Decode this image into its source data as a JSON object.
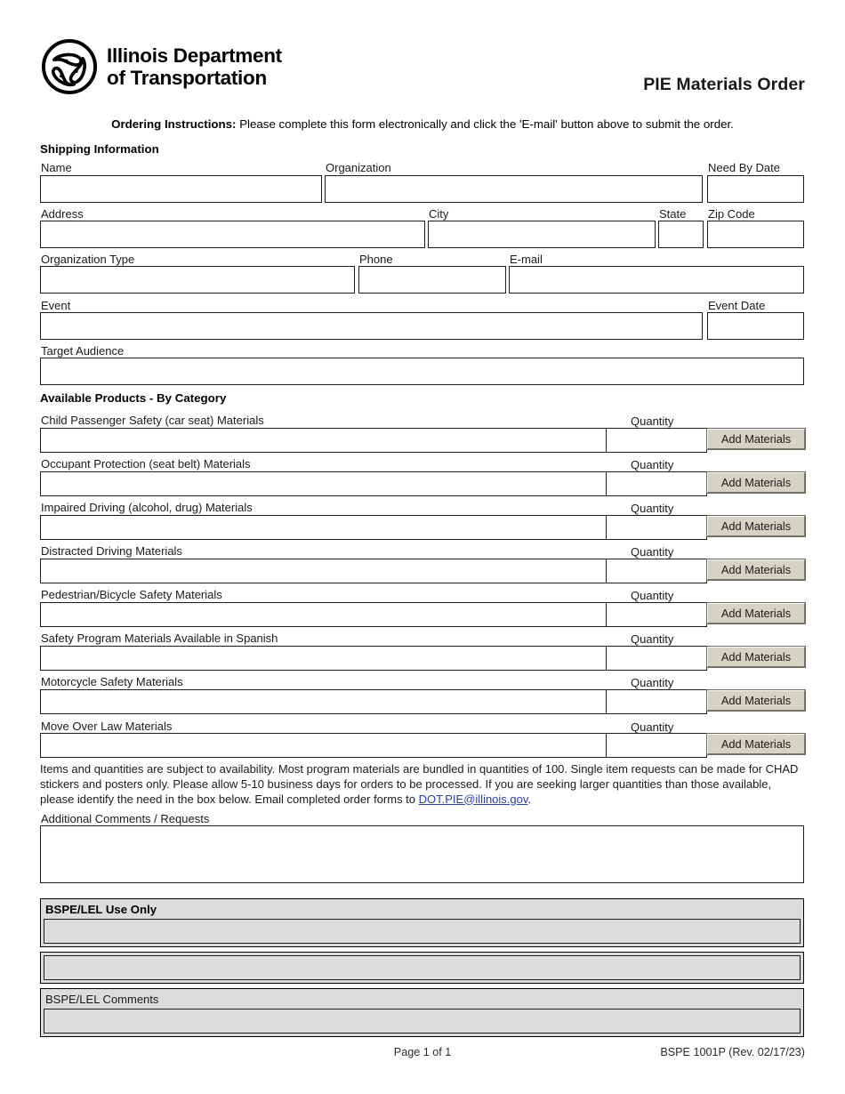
{
  "header": {
    "agency_line1": "Illinois Department",
    "agency_line2": "of Transportation",
    "logo_icon": "idot-triskelion-logo",
    "document_title": "PIE Materials Order"
  },
  "instructions": {
    "lead": "Ordering Instructions:",
    "text": "Please complete this form electronically and click the 'E-mail' button above to submit the order."
  },
  "shipping": {
    "title": "Shipping Information",
    "fields": [
      {
        "label": "Name",
        "value": "",
        "name": "name-field"
      },
      {
        "label": "Organization",
        "value": "",
        "name": "organization-field"
      },
      {
        "label": "Need By Date",
        "value": "",
        "name": "need-by-date-field"
      },
      {
        "label": "Address",
        "value": "",
        "name": "address-field"
      },
      {
        "label": "City",
        "value": "",
        "name": "city-field"
      },
      {
        "label": "State",
        "value": "",
        "name": "state-field"
      },
      {
        "label": "Zip Code",
        "value": "",
        "name": "zip-code-field"
      },
      {
        "label": "Organization Type",
        "value": "",
        "name": "organization-type-field"
      },
      {
        "label": "Phone",
        "value": "",
        "name": "phone-field"
      },
      {
        "label": "E-mail",
        "value": "",
        "name": "email-field"
      },
      {
        "label": "Event",
        "value": "",
        "name": "event-field"
      },
      {
        "label": "Event Date",
        "value": "",
        "name": "event-date-field"
      },
      {
        "label": "Target Audience",
        "value": "",
        "name": "target-audience-field"
      }
    ]
  },
  "products": {
    "title": "Available Products - By Category",
    "quantity_label": "Quantity",
    "add_button_label": "Add Materials",
    "categories": [
      {
        "label": "Child Passenger Safety (car seat) Materials",
        "materials": "",
        "quantity": ""
      },
      {
        "label": "Occupant Protection (seat belt) Materials",
        "materials": "",
        "quantity": ""
      },
      {
        "label": "Impaired Driving (alcohol, drug) Materials",
        "materials": "",
        "quantity": ""
      },
      {
        "label": "Distracted Driving Materials",
        "materials": "",
        "quantity": ""
      },
      {
        "label": "Pedestrian/Bicycle Safety Materials",
        "materials": "",
        "quantity": ""
      },
      {
        "label": "Safety Program Materials Available in Spanish",
        "materials": "",
        "quantity": ""
      },
      {
        "label": "Motorcycle Safety Materials",
        "materials": "",
        "quantity": ""
      },
      {
        "label": "Move Over Law Materials",
        "materials": "",
        "quantity": ""
      }
    ]
  },
  "notice": {
    "part1": "Items and quantities are subject to availability. Most program materials are bundled in quantities of 100. Single item requests can be made for CHAD stickers and posters only. Please allow 5-10 business days for orders to be processed. If you are seeking larger quantities than those available, please identify the need in the box below. Email completed order forms to ",
    "email_link": "DOT.PIE@illinois.gov",
    "part2": "."
  },
  "comments": {
    "label": "Additional Comments / Requests",
    "value": ""
  },
  "bspe": {
    "heading": "BSPE/LEL Use Only",
    "row1_value": "",
    "row2_value": "",
    "comments_label": "BSPE/LEL Comments",
    "comments_value": ""
  },
  "footer": {
    "page_number": "Page 1 of 1",
    "form_number": "BSPE 1001P (Rev. 02/17/23)"
  },
  "colors": {
    "button_face": "#d6d2c4",
    "bspe_panel": "#dcdcdc",
    "link": "#2b3fb0",
    "border": "#1c1c1c"
  }
}
